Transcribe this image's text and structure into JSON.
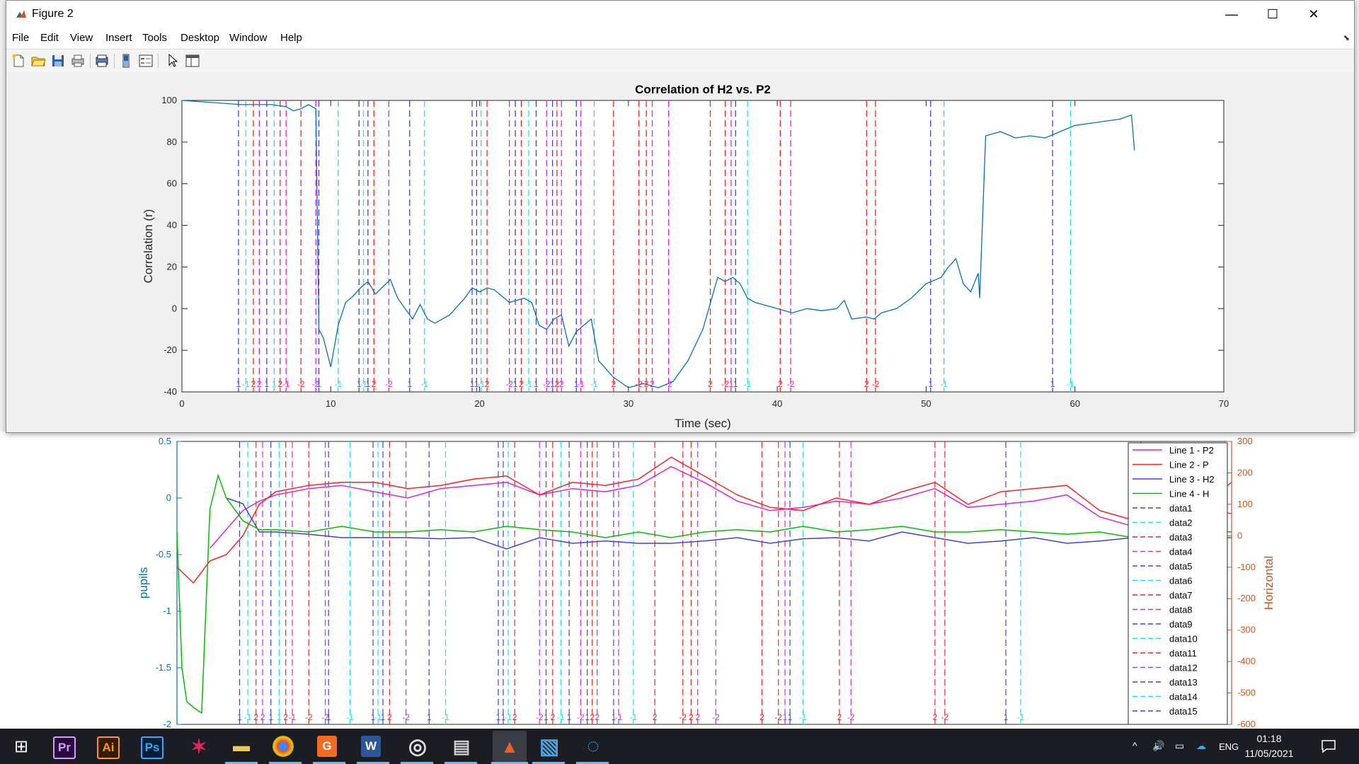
{
  "window": {
    "title": "Figure 2",
    "controls": {
      "minimize": "—",
      "maximize": "☐",
      "close": "✕"
    }
  },
  "menu": [
    "File",
    "Edit",
    "View",
    "Insert",
    "Tools",
    "Desktop",
    "Window",
    "Help"
  ],
  "toolbar_icons": [
    "new-figure-icon",
    "open-file-icon",
    "save-icon",
    "print-icon",
    "print-preview-icon",
    "colorbar-icon",
    "legend-icon",
    "pointer-icon",
    "property-editor-icon"
  ],
  "colors": {
    "series": "#0072bd",
    "marker_blue": "#4040e0",
    "marker_cyan": "#20e0e0",
    "marker_red": "#ff2020",
    "marker_magenta": "#e020e0",
    "axis_right": "#d95319"
  },
  "chart_data": [
    {
      "type": "line",
      "title": "Correlation of H2 vs. P2",
      "xlabel": "Time (sec)",
      "ylabel": "Correlation (r)",
      "xlim": [
        0,
        70
      ],
      "ylim": [
        -40,
        100
      ],
      "xticks": [
        0,
        10,
        20,
        30,
        40,
        50,
        60,
        70
      ],
      "yticks": [
        -40,
        -20,
        0,
        20,
        40,
        60,
        80,
        100
      ],
      "grid": false,
      "series": [
        {
          "x": [
            0,
            2,
            4,
            6,
            7,
            7.5,
            8,
            8.5,
            9,
            9.2,
            9.5,
            10,
            10.5,
            11,
            11.5,
            12,
            12.5,
            13,
            14,
            14.5,
            15,
            15.5,
            16,
            16.5,
            17,
            18,
            19,
            19.5,
            20,
            20.5,
            21,
            22,
            22.5,
            23,
            23.5,
            24,
            24.5,
            25,
            25.5,
            26,
            26.5,
            27,
            27.5,
            28,
            29,
            30,
            31,
            32,
            33,
            34,
            35,
            36,
            36.5,
            37,
            37.5,
            38,
            38.5,
            39,
            40,
            41,
            42,
            43,
            44,
            44.5,
            45,
            46,
            46.5,
            47,
            48,
            49,
            50,
            51,
            51.5,
            52,
            52.5,
            53,
            53.5,
            53.6,
            54,
            55,
            56,
            57,
            58,
            59,
            60,
            61,
            62,
            63,
            63.8,
            64
          ],
          "y": [
            100,
            99,
            98,
            98,
            97,
            95,
            96,
            98,
            96,
            -10,
            -14,
            -28,
            -8,
            3,
            6,
            10,
            13,
            7,
            14,
            5,
            0,
            -5,
            2,
            -5,
            -7,
            -3,
            5,
            10,
            8,
            10,
            9,
            3,
            4,
            5,
            3,
            -8,
            -10,
            -5,
            -3,
            -18,
            -11,
            -8,
            -5,
            -25,
            -33,
            -38,
            -36,
            -38,
            -35,
            -25,
            -10,
            15,
            13,
            15,
            12,
            5,
            3,
            2,
            0,
            -2,
            0,
            -1,
            0,
            4,
            -5,
            -4,
            -5,
            -2,
            0,
            5,
            12,
            15,
            20,
            24,
            12,
            8,
            17,
            5,
            83,
            85,
            82,
            83,
            82,
            85,
            88,
            89,
            90,
            91,
            93,
            76
          ]
        }
      ],
      "marker_lines": [
        {
          "x": 3.8,
          "color": "blue",
          "label": "1"
        },
        {
          "x": 4.3,
          "color": "cyan",
          "label": "-1"
        },
        {
          "x": 4.8,
          "color": "red",
          "label": "2"
        },
        {
          "x": 5.2,
          "color": "magenta",
          "label": "2"
        },
        {
          "x": 5.7,
          "color": "blue",
          "label": "1"
        },
        {
          "x": 6.2,
          "color": "cyan",
          "label": "1"
        },
        {
          "x": 6.6,
          "color": "red",
          "label": "2"
        },
        {
          "x": 7.0,
          "color": "magenta",
          "label": "-1"
        },
        {
          "x": 8.0,
          "color": "red",
          "label": "-2"
        },
        {
          "x": 9.0,
          "color": "magenta",
          "label": "-2"
        },
        {
          "x": 9.2,
          "color": "blue",
          "label": "1"
        },
        {
          "x": 10.5,
          "color": "cyan",
          "label": "-1"
        },
        {
          "x": 11.9,
          "color": "blue",
          "label": "1"
        },
        {
          "x": 12.2,
          "color": "cyan",
          "label": "-1"
        },
        {
          "x": 12.5,
          "color": "blue",
          "label": "1"
        },
        {
          "x": 12.9,
          "color": "red",
          "label": "2"
        },
        {
          "x": 13.9,
          "color": "magenta",
          "label": "-2"
        },
        {
          "x": 15.3,
          "color": "blue",
          "label": "1"
        },
        {
          "x": 16.3,
          "color": "cyan",
          "label": "-1"
        },
        {
          "x": 19.5,
          "color": "blue",
          "label": "1"
        },
        {
          "x": 19.8,
          "color": "blue",
          "label": "1"
        },
        {
          "x": 20.1,
          "color": "cyan",
          "label": "-1"
        },
        {
          "x": 20.5,
          "color": "red",
          "label": "2"
        },
        {
          "x": 22.0,
          "color": "magenta",
          "label": "-2"
        },
        {
          "x": 22.4,
          "color": "blue",
          "label": "1"
        },
        {
          "x": 22.8,
          "color": "red",
          "label": "2"
        },
        {
          "x": 23.3,
          "color": "cyan",
          "label": "-1"
        },
        {
          "x": 23.8,
          "color": "blue",
          "label": "1"
        },
        {
          "x": 24.5,
          "color": "magenta",
          "label": "-2"
        },
        {
          "x": 24.9,
          "color": "blue",
          "label": "1"
        },
        {
          "x": 25.2,
          "color": "red",
          "label": "2"
        },
        {
          "x": 25.5,
          "color": "magenta",
          "label": "2"
        },
        {
          "x": 26.5,
          "color": "blue",
          "label": "1"
        },
        {
          "x": 26.8,
          "color": "magenta",
          "label": "-1"
        },
        {
          "x": 27.7,
          "color": "cyan",
          "label": "-1"
        },
        {
          "x": 29.0,
          "color": "red",
          "label": "2"
        },
        {
          "x": 30.7,
          "color": "red",
          "label": "-2"
        },
        {
          "x": 31.2,
          "color": "red",
          "label": "2"
        },
        {
          "x": 31.6,
          "color": "magenta",
          "label": "2"
        },
        {
          "x": 32.7,
          "color": "magenta",
          "label": "-2"
        },
        {
          "x": 35.5,
          "color": "red",
          "label": "2"
        },
        {
          "x": 36.5,
          "color": "red",
          "label": "-2"
        },
        {
          "x": 36.9,
          "color": "magenta",
          "label": "1"
        },
        {
          "x": 37.2,
          "color": "blue",
          "label": "1"
        },
        {
          "x": 38.0,
          "color": "cyan",
          "label": "-1"
        },
        {
          "x": 40.2,
          "color": "red",
          "label": "2"
        },
        {
          "x": 40.9,
          "color": "magenta",
          "label": "-2"
        },
        {
          "x": 46.0,
          "color": "red",
          "label": "2"
        },
        {
          "x": 46.6,
          "color": "red",
          "label": "-2"
        },
        {
          "x": 50.3,
          "color": "blue",
          "label": "1"
        },
        {
          "x": 51.2,
          "color": "cyan",
          "label": "-1"
        },
        {
          "x": 58.5,
          "color": "blue",
          "label": "1"
        },
        {
          "x": 59.7,
          "color": "cyan",
          "label": "-1"
        }
      ]
    },
    {
      "type": "line",
      "ylabel_left": "pupils",
      "ylabel_right": "Horizontal",
      "ylim_left": [
        -2,
        0.5
      ],
      "ylim_right": [
        -600,
        300
      ],
      "yticks_left": [
        0.5,
        0,
        -0.5,
        -1,
        -1.5,
        -2
      ],
      "yticks_right": [
        300,
        200,
        100,
        0,
        -100,
        -200,
        -300,
        -400,
        -500,
        -600
      ],
      "legend_position": "right",
      "legend": [
        "Line 1 - P2",
        "Line 2 - P",
        "Line 3 - H2",
        "Line 4 - H",
        "data1",
        "data2",
        "data3",
        "data4",
        "data5",
        "data6",
        "data7",
        "data8",
        "data9",
        "data10",
        "data11",
        "data12",
        "data13",
        "data14",
        "data15"
      ],
      "series": [
        {
          "name": "Line 1 - P2",
          "color": "magenta",
          "x": [
            2,
            3,
            4,
            5,
            6,
            8,
            10,
            12,
            14,
            16,
            18,
            20,
            22,
            24,
            26,
            28,
            30,
            32,
            34,
            36,
            38,
            40,
            42,
            44,
            46,
            48,
            50,
            52,
            54,
            56,
            58,
            60,
            62,
            64
          ],
          "y": [
            -40,
            20,
            80,
            110,
            130,
            150,
            160,
            140,
            120,
            150,
            160,
            170,
            130,
            150,
            140,
            160,
            220,
            170,
            110,
            80,
            90,
            110,
            100,
            120,
            150,
            90,
            100,
            110,
            130,
            60,
            30,
            60,
            90,
            70
          ]
        },
        {
          "name": "Line 2 - P",
          "color": "red",
          "x": [
            0,
            1,
            2,
            3,
            4,
            5,
            6,
            8,
            10,
            12,
            14,
            16,
            18,
            20,
            22,
            24,
            26,
            28,
            30,
            32,
            34,
            36,
            38,
            40,
            42,
            44,
            46,
            48,
            50,
            52,
            54,
            56,
            58,
            60,
            62,
            64
          ],
          "y": [
            -100,
            -150,
            -80,
            -60,
            0,
            100,
            140,
            160,
            170,
            170,
            150,
            160,
            180,
            190,
            130,
            170,
            160,
            180,
            250,
            190,
            130,
            90,
            80,
            120,
            100,
            140,
            170,
            100,
            140,
            150,
            160,
            80,
            50,
            -20,
            90,
            170
          ]
        },
        {
          "name": "Line 3 - H2",
          "color": "blue",
          "x": [
            3,
            4,
            5,
            6,
            8,
            10,
            12,
            14,
            16,
            18,
            20,
            22,
            24,
            26,
            28,
            30,
            32,
            34,
            36,
            38,
            40,
            42,
            44,
            46,
            48,
            50,
            52,
            54,
            56,
            58,
            60,
            62,
            64
          ],
          "y": [
            0,
            -0.05,
            -0.3,
            -0.3,
            -0.32,
            -0.35,
            -0.35,
            -0.35,
            -0.36,
            -0.35,
            -0.45,
            -0.35,
            -0.4,
            -0.38,
            -0.4,
            -0.4,
            -0.38,
            -0.35,
            -0.4,
            -0.36,
            -0.35,
            -0.38,
            -0.3,
            -0.35,
            -0.4,
            -0.38,
            -0.35,
            -0.4,
            -0.38,
            -0.35,
            -0.38,
            -0.35,
            -0.35
          ]
        },
        {
          "name": "Line 4 - H",
          "color": "green",
          "x": [
            0,
            0.3,
            0.6,
            1,
            1.5,
            2,
            2.5,
            3,
            4,
            5,
            6,
            8,
            10,
            12,
            14,
            16,
            18,
            20,
            22,
            24,
            26,
            28,
            30,
            32,
            34,
            36,
            38,
            40,
            42,
            44,
            46,
            48,
            50,
            52,
            54,
            56,
            58,
            59,
            60,
            62,
            64
          ],
          "y": [
            -0.3,
            -1.5,
            -1.8,
            -1.85,
            -1.9,
            -0.1,
            0.2,
            0,
            -0.2,
            -0.28,
            -0.28,
            -0.3,
            -0.25,
            -0.3,
            -0.3,
            -0.28,
            -0.3,
            -0.25,
            -0.28,
            -0.3,
            -0.35,
            -0.3,
            -0.35,
            -0.3,
            -0.28,
            -0.3,
            -0.25,
            -0.3,
            -0.28,
            -0.25,
            -0.3,
            -0.3,
            -0.28,
            -0.3,
            -0.32,
            -0.3,
            -0.35,
            -1.75,
            -0.3,
            -0.28,
            -0.3
          ]
        }
      ]
    }
  ],
  "taskbar": {
    "apps": [
      {
        "name": "start",
        "glyph": "⊞"
      },
      {
        "name": "premiere-pro",
        "glyph": "Pr"
      },
      {
        "name": "illustrator",
        "glyph": "Ai"
      },
      {
        "name": "photoshop",
        "glyph": "Ps"
      },
      {
        "name": "app-red",
        "glyph": "✶"
      },
      {
        "name": "file-explorer",
        "glyph": "▬"
      },
      {
        "name": "chrome",
        "glyph": "◉"
      },
      {
        "name": "pdf-app",
        "glyph": "G"
      },
      {
        "name": "word",
        "glyph": "W"
      },
      {
        "name": "media-player",
        "glyph": "◎"
      },
      {
        "name": "printer-app",
        "glyph": "▤"
      },
      {
        "name": "matlab",
        "glyph": "▲"
      },
      {
        "name": "photos",
        "glyph": "▧"
      },
      {
        "name": "circle-app",
        "glyph": "◌"
      }
    ],
    "tray": {
      "chevron": "^",
      "volume": "🔊",
      "network": "▭",
      "cloud": "☁",
      "language": "ENG"
    },
    "time": "01:18",
    "date": "11/05/2021"
  }
}
